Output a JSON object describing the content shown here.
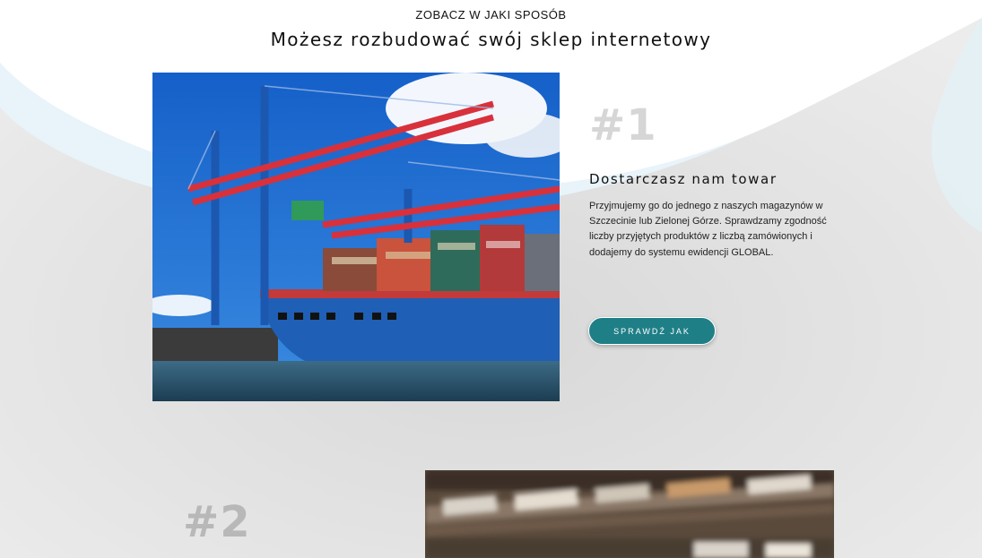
{
  "section": {
    "eyebrow": "ZOBACZ W JAKI SPOSÓB",
    "title": "Możesz rozbudować swój sklep internetowy"
  },
  "steps": [
    {
      "number": "#1",
      "title": "Dostarczasz nam towar",
      "description": "Przyjmujemy go do jednego z naszych magazynów w Szczecinie lub Zielonej Górze. Sprawdzamy zgodność liczby przyjętych produktów z liczbą zamówionych i dodajemy do systemu ewidencji GLOBAL.",
      "button_label": "SPRAWDŹ JAK",
      "image": "container-ship-port-photo"
    },
    {
      "number": "#2",
      "image": "warehouse-shelves-photo"
    }
  ],
  "colors": {
    "accent": "#1f7f86",
    "background": "#e4e4e4",
    "top_wave": "#ffffff",
    "side_tint": "#e6f3f9"
  }
}
